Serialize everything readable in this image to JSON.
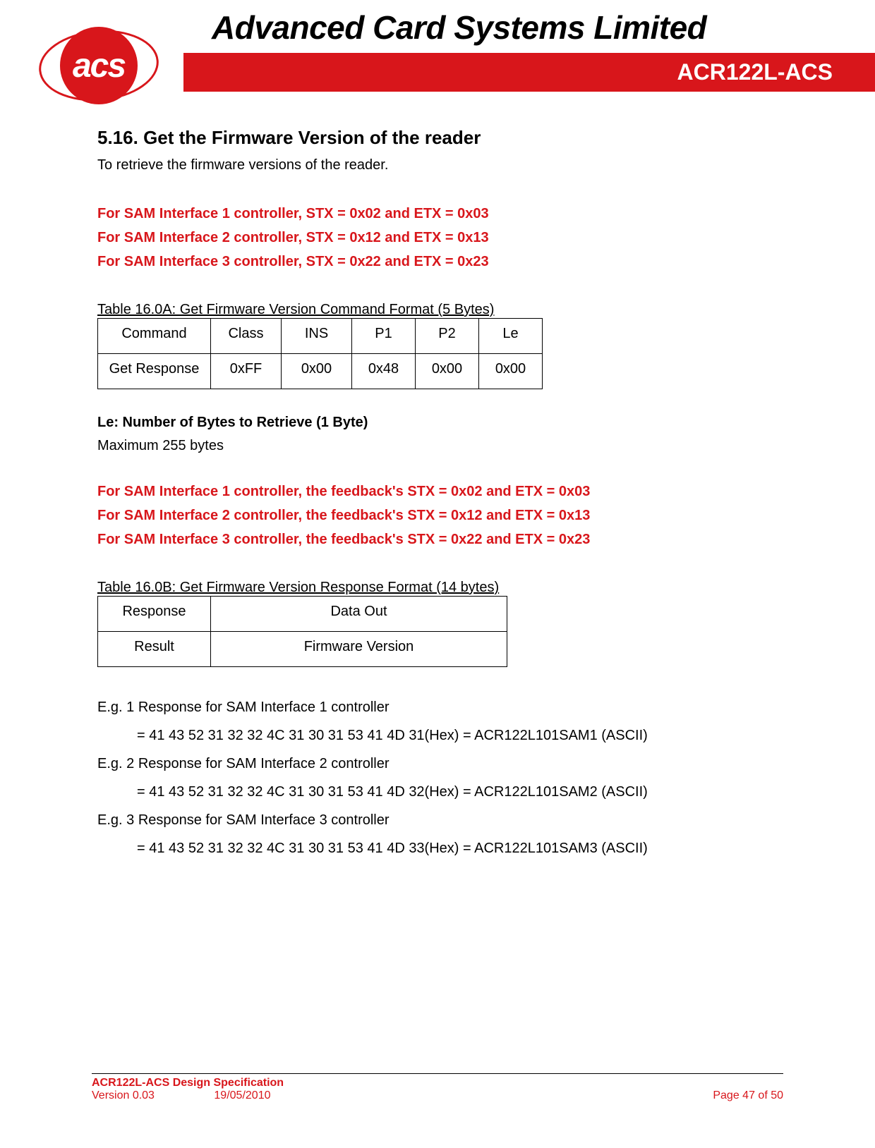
{
  "header": {
    "logo_text": "acs",
    "company_name": "Advanced Card Systems Limited",
    "product_name": "ACR122L-ACS"
  },
  "section": {
    "number": "5.16.",
    "title": "Get the Firmware Version of the reader",
    "intro": "To retrieve the firmware versions of the reader."
  },
  "sam_controllers_a": [
    "For SAM Interface 1 controller, STX = 0x02 and ETX = 0x03",
    "For SAM Interface 2 controller, STX = 0x12 and ETX = 0x13",
    "For SAM Interface 3 controller, STX = 0x22 and ETX = 0x23"
  ],
  "table_a": {
    "caption": "Table 16.0A: Get Firmware Version Command Format (5 Bytes)",
    "headers": [
      "Command",
      "Class",
      "INS",
      "P1",
      "P2",
      "Le"
    ],
    "row": [
      "Get Response",
      "0xFF",
      "0x00",
      "0x48",
      "0x00",
      "0x00"
    ]
  },
  "le": {
    "label": "Le: Number of Bytes to Retrieve (1 Byte)",
    "desc": "Maximum 255 bytes"
  },
  "sam_controllers_b": [
    "For SAM Interface 1 controller, the feedback's STX = 0x02 and ETX = 0x03",
    "For SAM Interface 2 controller, the feedback's STX = 0x12 and ETX = 0x13",
    "For SAM Interface 3 controller, the feedback's STX = 0x22 and ETX = 0x23"
  ],
  "table_b": {
    "caption": "Table 16.0B: Get Firmware Version Response Format (14 bytes)",
    "headers": [
      "Response",
      "Data Out"
    ],
    "row": [
      "Result",
      "Firmware Version"
    ]
  },
  "examples": [
    {
      "label": "E.g. 1 Response for SAM Interface 1 controller",
      "value": "= 41 43 52 31 32 32 4C 31 30 31 53 41 4D 31(Hex) = ACR122L101SAM1 (ASCII)"
    },
    {
      "label": "E.g. 2 Response for SAM Interface 2 controller",
      "value": "= 41 43 52 31 32 32 4C 31 30 31 53 41 4D 32(Hex) = ACR122L101SAM2 (ASCII)"
    },
    {
      "label": "E.g. 3 Response for SAM Interface 3 controller",
      "value": "= 41 43 52 31 32 32 4C 31 30 31 53 41 4D 33(Hex) = ACR122L101SAM3 (ASCII)"
    }
  ],
  "footer": {
    "spec_title": "ACR122L-ACS Design Specification",
    "version": "Version 0.03",
    "date": "19/05/2010",
    "page": "Page 47 of 50"
  }
}
